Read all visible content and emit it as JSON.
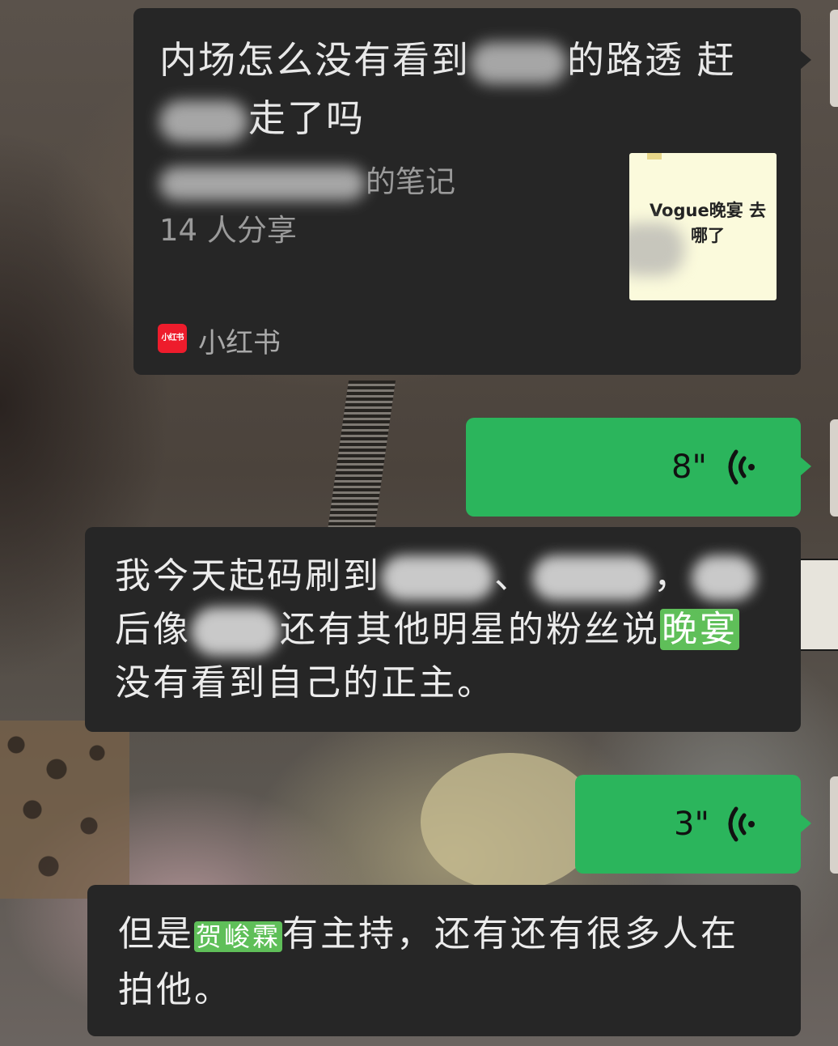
{
  "link_card": {
    "title_part1": "内场怎么没有看到",
    "title_part2": "的路透 赶",
    "title_part3": "走了吗",
    "author_suffix": "的笔记",
    "share_count": "14 人分享",
    "thumbnail_text": "Vogue晚宴 去哪了",
    "source_logo_text": "小红书",
    "source_name": "小红书"
  },
  "voice_messages": [
    {
      "duration": "8\""
    },
    {
      "duration": "3\""
    }
  ],
  "message_1": {
    "line1_start": "我今天起码刷到",
    "line1_sep1": "、",
    "line1_sep2": "，",
    "line2_start": "后像",
    "line2_mid": "还有其他明星的粉丝说",
    "highlight": "晚宴",
    "line3": "没有看到自己的正主。"
  },
  "message_2": {
    "prefix": "但是",
    "highlight": "贺峻霖",
    "line1_rest": "有主持，还有还有很多人在",
    "line2": "拍他。"
  },
  "colors": {
    "bubble_dark": "#262626",
    "bubble_green": "#2bb55c",
    "highlight_green": "#5fbf59",
    "brand_red": "#ee1c2c"
  }
}
